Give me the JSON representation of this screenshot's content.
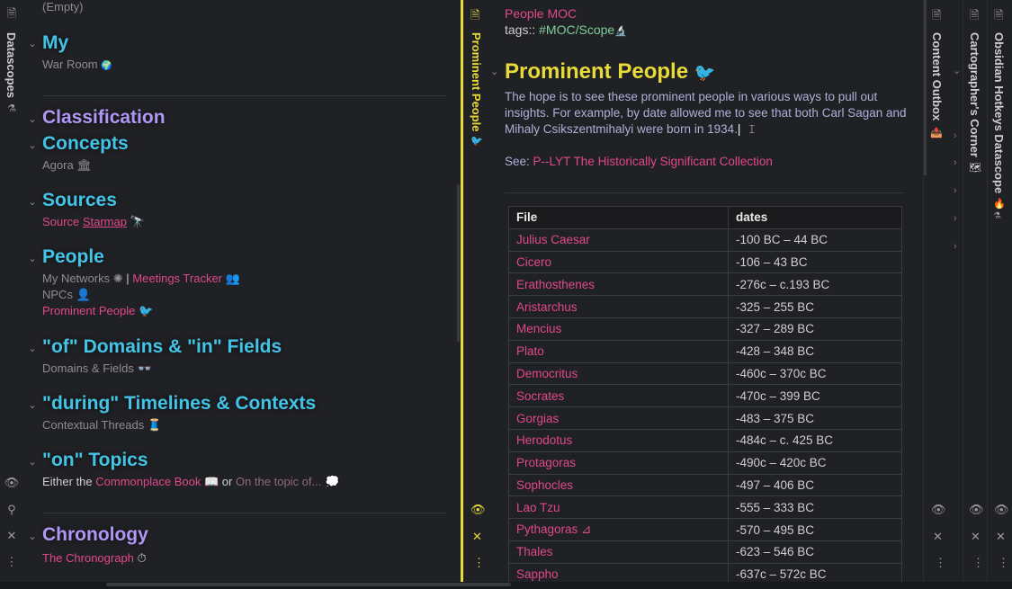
{
  "left": {
    "strip_title": "Datascopes",
    "empty_label": "(Empty)",
    "sections": {
      "my": {
        "title": "My",
        "items": [
          "War Room"
        ]
      },
      "classification": {
        "title": "Classification"
      },
      "concepts": {
        "title": "Concepts",
        "items": [
          "Agora"
        ]
      },
      "sources": {
        "title": "Sources",
        "link_text": "Source",
        "link_text2": "Starmap"
      },
      "people": {
        "title": "People",
        "my_networks": "My Networks",
        "separator": "|",
        "meetings": "Meetings Tracker",
        "npcs": "NPCs",
        "prominent": "Prominent People"
      },
      "domains": {
        "title": "\"of\" Domains & \"in\" Fields",
        "items": [
          "Domains & Fields"
        ]
      },
      "timelines": {
        "title": "\"during\" Timelines & Contexts",
        "items": [
          "Contextual Threads"
        ]
      },
      "topics": {
        "title": "\"on\" Topics",
        "prefix": "Either the",
        "link": "Commonplace Book",
        "or": "or",
        "link2": "On the topic of..."
      },
      "chronology": {
        "title": "Chronology",
        "items": [
          "The Chronograph"
        ]
      }
    }
  },
  "center": {
    "strip_title": "Prominent People",
    "moc_link": "People MOC",
    "tags_label": "tags::",
    "tags_value": "#MOC/Scope",
    "heading": "Prominent People",
    "para_lines": [
      "The hope is to see these prominent people in various ways to pull out",
      "insights. For example, by date allowed me to see that both Carl Sagan and",
      "Mihaly Csikszentmihalyi were born in 1934."
    ],
    "see_label": "See:",
    "see_link": "P--LYT The Historically Significant Collection",
    "table": {
      "headers": [
        "File",
        "dates"
      ],
      "rows": [
        [
          "Julius Caesar",
          "-100 BC – 44 BC"
        ],
        [
          "Cicero",
          "-106 – 43 BC"
        ],
        [
          "Erathosthenes",
          "-276c – c.193 BC"
        ],
        [
          "Aristarchus",
          "-325 – 255 BC"
        ],
        [
          "Mencius",
          "-327 – 289 BC"
        ],
        [
          "Plato",
          "-428 – 348 BC"
        ],
        [
          "Democritus",
          "-460c – 370c BC"
        ],
        [
          "Socrates",
          "-470c – 399 BC"
        ],
        [
          "Gorgias",
          "-483 – 375 BC"
        ],
        [
          "Herodotus",
          "-484c – c. 425 BC"
        ],
        [
          "Protagoras",
          "-490c – 420c BC"
        ],
        [
          "Sophocles",
          "-497 – 406 BC"
        ],
        [
          "Lao Tzu",
          "-555 – 333 BC"
        ],
        [
          "Pythagoras ⊿",
          "-570 – 495 BC"
        ],
        [
          "Thales",
          "-623 – 546 BC"
        ],
        [
          "Sappho",
          "-637c – 572c BC"
        ]
      ]
    }
  },
  "right": {
    "content_outbox": "Content Outbox",
    "cartographer": "Cartographer's Corner",
    "hotkeys": "Obsidian Hotkeys Datascope"
  },
  "colors": {
    "heading_blue": "#43c4e6",
    "heading_purple": "#b197f5",
    "link_pink": "#e0488a",
    "muted": "#8d8d8d",
    "yellow": "#e8db39",
    "tag_green": "#7fcf9a"
  }
}
